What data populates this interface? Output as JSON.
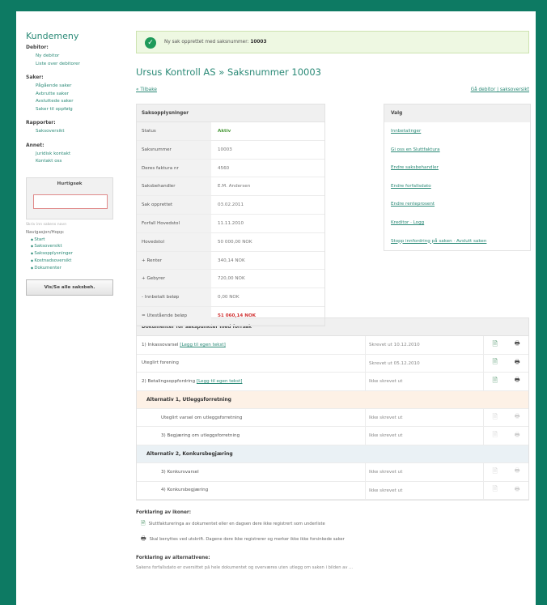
{
  "sidebar": {
    "title": "Kundemeny",
    "sections": [
      {
        "head": "Debitor:",
        "links": [
          "Ny debitor",
          "Liste over debitorer"
        ]
      },
      {
        "head": "Saker:",
        "links": [
          "Pågående saker",
          "Avbrutte saker",
          "Avsluttede saker",
          "Saker til oppfølg"
        ]
      },
      {
        "head": "Rapporter:",
        "links": [
          "Saksoversikt"
        ]
      },
      {
        "head": "Annet:",
        "links": [
          "Juridisk kontakt",
          "Kontakt oss"
        ]
      }
    ],
    "quick_title": "Hurtigsøk",
    "quick_hint": "Skriv inn sakens navn",
    "nav_head": "Navigasjon/Hopp:",
    "nav_links": [
      "Start",
      "Saksoversikt",
      "Saksopplysninger",
      "Kostnadsoversikt",
      "Dokumenter"
    ],
    "button": "Vis/Se alle saksbeh."
  },
  "message": {
    "prefix": "Ny sak opprettet med saksnummer:",
    "number": "10003"
  },
  "title": "Ursus Kontroll AS » Saksnummer 10003",
  "back_link": "« Tilbake",
  "right_link": "Gå debitor | saksoversikt",
  "info": {
    "head": "Saksopplysninger",
    "rows": [
      {
        "label": "Status",
        "value": "Aktiv",
        "style": "green"
      },
      {
        "label": "Saksnummer",
        "value": "10003",
        "style": ""
      },
      {
        "label": "Deres faktura nr",
        "value": "4560",
        "style": ""
      },
      {
        "label": "Saksbehandler",
        "value": "E.M. Andersen",
        "style": ""
      },
      {
        "label": "Sak opprettet",
        "value": "03.02.2011",
        "style": ""
      },
      {
        "label": "Forfall Hovedstol",
        "value": "11.11.2010",
        "style": ""
      },
      {
        "label": "Hovedstol",
        "value": "50 000,00 NOK",
        "style": ""
      },
      {
        "label": "+ Renter",
        "value": "340,14 NOK",
        "style": ""
      },
      {
        "label": "+ Gebyrer",
        "value": "720,00 NOK",
        "style": ""
      },
      {
        "label": "- Innbetalt beløp",
        "value": "0,00 NOK",
        "style": ""
      },
      {
        "label": "= Utestående beløp",
        "value": "51 060,14 NOK",
        "style": "red"
      }
    ]
  },
  "valg": {
    "head": "Valg",
    "links": [
      "Innbetalinger",
      "Gi oss en Sluttfaktura",
      "Endre saksbehandler",
      "Endre forfallsdato",
      "Endre renteprosent",
      "Kreditor · Logg",
      "Stopp innfordring på saken · Avslutt saken"
    ]
  },
  "docs": {
    "head": "Dokumenter for sakspunkter med forrsak",
    "rows": [
      {
        "type": "doc",
        "name": "1) Inkassovarsel",
        "link": "[Legg til egen tekst]",
        "status": "Skrevet ut 10.12.2010",
        "active": true
      },
      {
        "type": "doc",
        "name": "Uteglirt forening",
        "link": "",
        "status": "Skrevet ut 05.12.2010",
        "active": true
      },
      {
        "type": "doc",
        "name": "2) Betalingsoppfordring",
        "link": "[Legg til egen tekst]",
        "status": "Ikke skrevet ut",
        "active": true
      },
      {
        "type": "alt",
        "name": "Alternativ 1, Utleggsforretning",
        "tone": "one"
      },
      {
        "type": "doc",
        "name": "Uteglirt varsel om utleggsforretning",
        "link": "",
        "status": "Ikke skrevet ut",
        "active": false,
        "indent": true
      },
      {
        "type": "doc",
        "name": "3) Begjæring om utleggsforretning",
        "link": "",
        "status": "Ikke skrevet ut",
        "active": false,
        "indent": true
      },
      {
        "type": "alt",
        "name": "Alternativ 2, Konkursbegjæring",
        "tone": "two"
      },
      {
        "type": "doc",
        "name": "3) Konkursvarsel",
        "link": "",
        "status": "Ikke skrevet ut",
        "active": false,
        "indent": true
      },
      {
        "type": "doc",
        "name": "4) Konkursbegjæring",
        "link": "",
        "status": "Ikke skrevet ut",
        "active": false,
        "indent": true
      }
    ]
  },
  "explain": {
    "title": "Forklaring av ikoner:",
    "line1": "Sluttfaktureringa av dokumentet eller en dagsen dere ikke registrert som underliste",
    "line2": "Skal benyttes ved utskrift. Dagene dere ikke registrerer og merker ikke ikke forsinkede saker",
    "title2": "Forklaring av alternativene:",
    "line3": "Sakens forfallsdato er oversittet på hele dokumentet og overværes uten utlegg om saken i bilden av ..."
  }
}
